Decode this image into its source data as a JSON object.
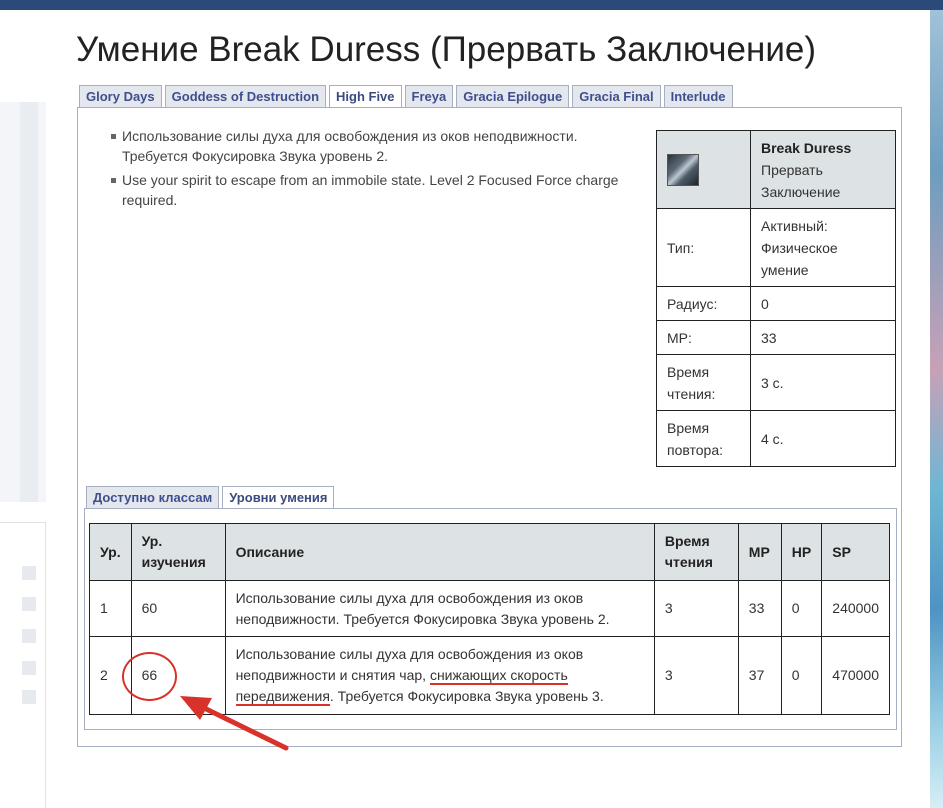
{
  "page": {
    "title": "Умение Break Duress (Прервать Заключение)"
  },
  "version_tabs": [
    {
      "label": "Glory Days",
      "active": false
    },
    {
      "label": "Goddess of Destruction",
      "active": false
    },
    {
      "label": "High Five",
      "active": true
    },
    {
      "label": "Freya",
      "active": false
    },
    {
      "label": "Gracia Epilogue",
      "active": false
    },
    {
      "label": "Gracia Final",
      "active": false
    },
    {
      "label": "Interlude",
      "active": false
    }
  ],
  "descriptions": [
    "Использование силы духа для освобождения из оков неподвижности. Требуется Фокусировка Звука уровень 2.",
    "Use your spirit to escape from an immobile state. Level 2 Focused Force charge required."
  ],
  "info_box": {
    "icon": "break-duress-skill-icon",
    "name": "Break Duress",
    "name_ru": "Прервать Заключение",
    "rows": [
      {
        "label": "Тип:",
        "value": "Активный: Физическое умение"
      },
      {
        "label": "Радиус:",
        "value": "0"
      },
      {
        "label": "MP:",
        "value": "33"
      },
      {
        "label": "Время чтения:",
        "value": "3 с."
      },
      {
        "label": "Время повтора:",
        "value": "4 с."
      }
    ]
  },
  "sub_tabs": [
    {
      "label": "Доступно классам",
      "active": false
    },
    {
      "label": "Уровни умения",
      "active": true
    }
  ],
  "levels_table": {
    "headers": [
      "Ур.",
      "Ур. изучения",
      "Описание",
      "Время чтения",
      "MP",
      "HP",
      "SP"
    ],
    "rows": [
      {
        "lvl": "1",
        "learn": "60",
        "desc_a": "Использование силы духа для освобождения из оков неподвижности. Требуется Фокусировка Звука уровень 2.",
        "desc_b": "",
        "desc_c": "",
        "cast": "3",
        "mp": "33",
        "hp": "0",
        "sp": "240000"
      },
      {
        "lvl": "2",
        "learn": "66",
        "desc_a": "Использование силы духа для освобождения из оков неподвижности и снятия чар, ",
        "desc_b": "снижающих скорость передвижения",
        "desc_c": ". Требуется Фокусировка Звука уровень 3.",
        "cast": "3",
        "mp": "37",
        "hp": "0",
        "sp": "470000"
      }
    ]
  },
  "annotation_color": "#d8322a"
}
